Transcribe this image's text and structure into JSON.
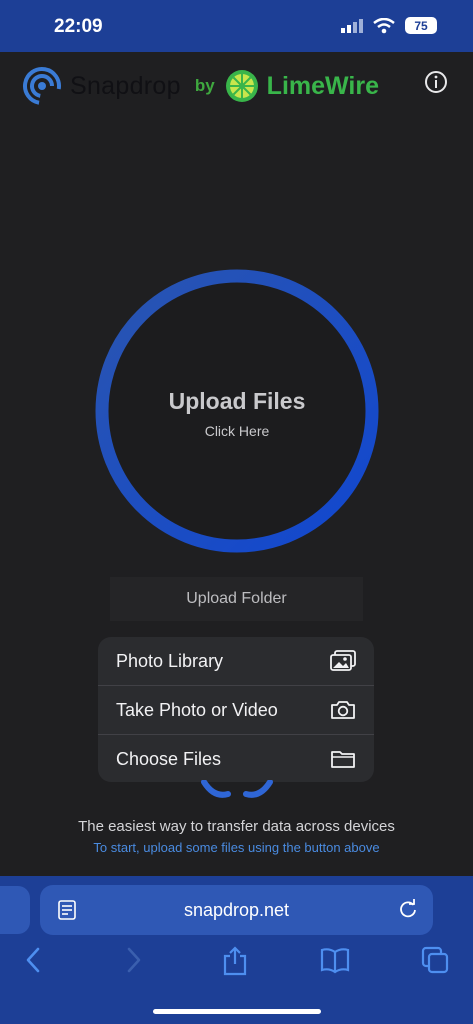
{
  "status": {
    "time": "22:09",
    "battery": "75"
  },
  "header": {
    "brand": "Snapdrop",
    "by": "by",
    "partner": "LimeWire"
  },
  "upload": {
    "title": "Upload Files",
    "subtitle": "Click Here"
  },
  "folder_button": "Upload Folder",
  "menu": {
    "items": [
      {
        "label": "Photo Library",
        "icon": "photo-library-icon"
      },
      {
        "label": "Take Photo or Video",
        "icon": "camera-icon"
      },
      {
        "label": "Choose Files",
        "icon": "folder-icon"
      }
    ]
  },
  "tagline": "The easiest way to transfer data across devices",
  "hint": "To start, upload some files using the button above",
  "browser": {
    "url": "snapdrop.net"
  },
  "colors": {
    "bar": "#1d3f96",
    "ring": "#1f4fc0",
    "lime": "#39b54a",
    "link": "#4a8be0"
  }
}
